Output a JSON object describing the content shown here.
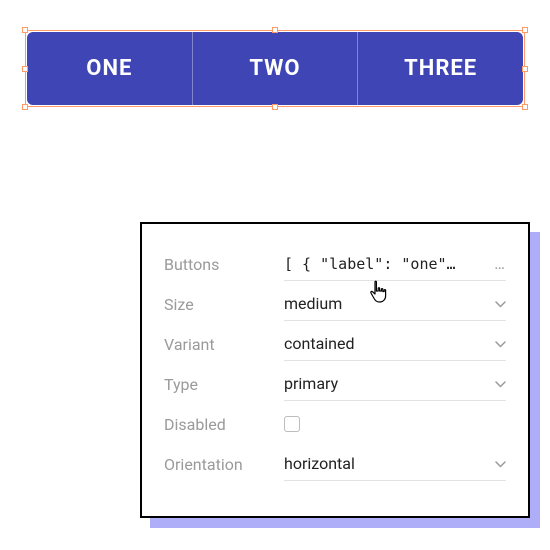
{
  "buttonGroup": {
    "items": [
      {
        "label": "ONE"
      },
      {
        "label": "TWO"
      },
      {
        "label": "THREE"
      }
    ]
  },
  "panel": {
    "buttons": {
      "label": "Buttons",
      "value": "[ { \"label\": \"one\"…"
    },
    "size": {
      "label": "Size",
      "value": "medium"
    },
    "variant": {
      "label": "Variant",
      "value": "contained"
    },
    "type": {
      "label": "Type",
      "value": "primary"
    },
    "disabled": {
      "label": "Disabled",
      "checked": false
    },
    "orientation": {
      "label": "Orientation",
      "value": "horizontal"
    }
  },
  "colors": {
    "primary": "#3f45b5",
    "selection": "#ff9966",
    "panelShadow": "#6b6cf2"
  }
}
